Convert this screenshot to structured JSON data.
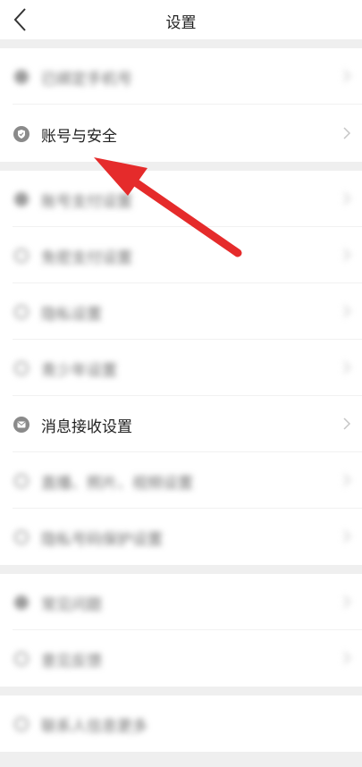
{
  "header": {
    "title": "设置"
  },
  "rows": [
    {
      "label": "已绑定手机号"
    },
    {
      "label": "账号与安全"
    },
    {
      "label": "账号支付设置"
    },
    {
      "label": "免密支付设置"
    },
    {
      "label": "隐私设置"
    },
    {
      "label": "青少年设置"
    },
    {
      "label": "消息接收设置"
    },
    {
      "label": "直播、照片、视频设置"
    },
    {
      "label": "隐私号码保护设置"
    },
    {
      "label": "常见问题"
    },
    {
      "label": "意见反馈"
    },
    {
      "label": "联系人信息更多"
    }
  ],
  "colors": {
    "accent_red": "#e52b2b",
    "icon_gray": "#8a8a8a",
    "separator": "#efefef"
  }
}
